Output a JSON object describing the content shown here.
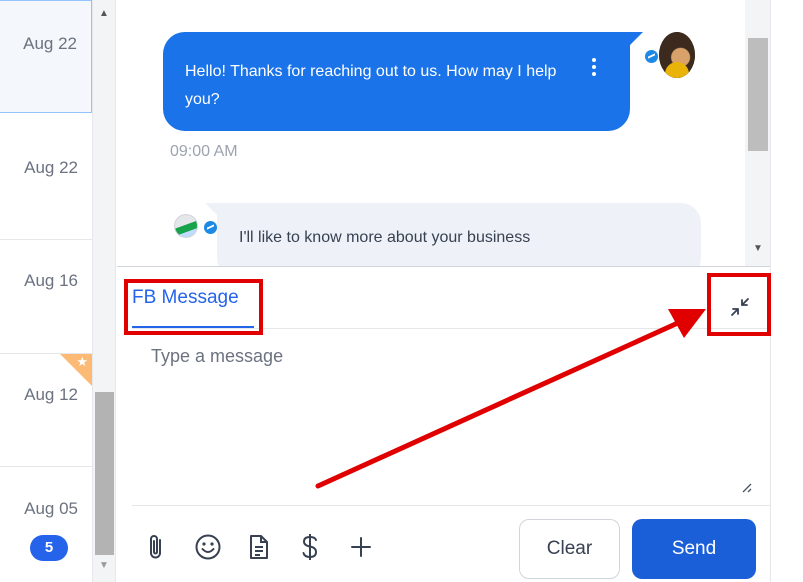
{
  "conversation_list": {
    "items": [
      {
        "date": "Aug 22",
        "active": true,
        "starred": false
      },
      {
        "date": "Aug 22",
        "active": false,
        "starred": false
      },
      {
        "date": "Aug 16",
        "active": false,
        "starred": false
      },
      {
        "date": "Aug 12",
        "active": false,
        "starred": true
      },
      {
        "date": "Aug 05",
        "active": false,
        "starred": false,
        "unread_count": "5"
      }
    ]
  },
  "chat": {
    "messages": [
      {
        "direction": "outbound",
        "channel": "messenger-icon",
        "text": "Hello! Thanks for reaching out to us. How may I help you?",
        "time": "09:00 AM"
      },
      {
        "direction": "inbound",
        "channel": "messenger-icon",
        "text": "I'll like to know more about your business"
      }
    ]
  },
  "composer": {
    "active_tab": "FB Message",
    "placeholder": "Type a message",
    "value": "",
    "tools": [
      "attachment-icon",
      "emoji-icon",
      "template-icon",
      "payment-icon",
      "plus-icon"
    ],
    "clear_label": "Clear",
    "send_label": "Send"
  },
  "annotations": {
    "color": "#e00000",
    "highlights": [
      "FB Message tab",
      "collapse composer icon"
    ],
    "arrow": "points to collapse composer icon"
  },
  "colors": {
    "accent": "#1a73e8",
    "send_button": "#1a5fd8",
    "badge": "#2563eb",
    "star_corner": "#fdba74"
  }
}
